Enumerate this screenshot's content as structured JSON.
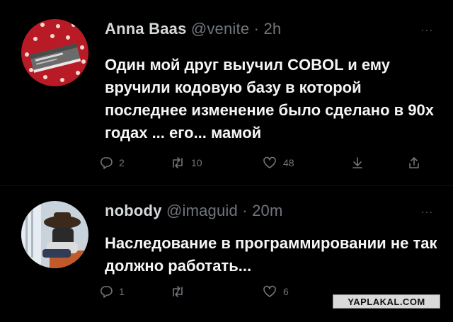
{
  "tweets": [
    {
      "name": "Anna Baas",
      "handle": "@venite",
      "dot": "·",
      "time": "2h",
      "more": "···",
      "text": "Один мой друг выучил COBOL и ему вручили кодовую базу в которой последнее изменение было сделано в 90х годах ... его... мамой",
      "avatar_icon": "polka-dot-cobol-book-avatar",
      "actions": {
        "reply_count": "2",
        "retweet_count": "10",
        "like_count": "48",
        "reply_icon": "comment-icon",
        "retweet_icon": "retweet-icon",
        "like_icon": "heart-icon",
        "save_icon": "download-icon",
        "share_icon": "share-icon"
      }
    },
    {
      "name": "nobody",
      "handle": "@imaguid",
      "dot": "·",
      "time": "20m",
      "more": "···",
      "text": "Наследование в программировании не так должно работать...",
      "avatar_icon": "man-in-hat-sleeping-avatar",
      "actions": {
        "reply_count": "1",
        "retweet_count": "",
        "like_count": "6",
        "reply_icon": "comment-icon",
        "retweet_icon": "retweet-icon",
        "like_icon": "heart-icon",
        "save_icon": "download-icon",
        "share_icon": "share-icon"
      }
    }
  ],
  "watermark": "YAPLAKAL.COM",
  "colors": {
    "background": "#000000",
    "text": "#e7e9ea",
    "muted": "#71767b",
    "avatar1": "#c0202a"
  }
}
